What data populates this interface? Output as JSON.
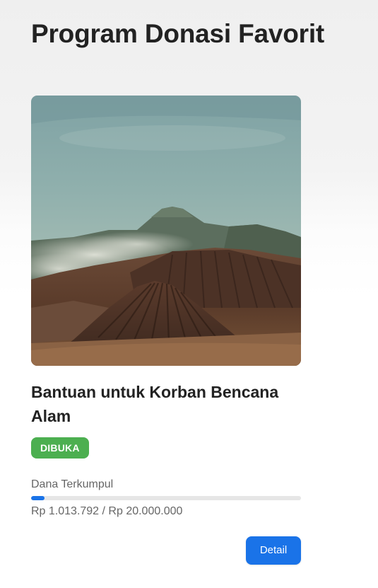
{
  "page": {
    "title": "Program Donasi Favorit"
  },
  "card": {
    "image_subject": "volcano-landscape-photo",
    "title": "Bantuan untuk Korban Bencana Alam",
    "status": "DIBUKA",
    "progress_label": "Dana Terkumpul",
    "collected": 1013792,
    "target": 20000000,
    "amount_text": "Rp 1.013.792 / Rp 20.000.000",
    "detail_label": "Detail"
  },
  "colors": {
    "accent": "#1a73e8",
    "status_open": "#4caf50",
    "title_text": "#222222",
    "muted_text": "#666666",
    "track": "#e6e6e6"
  }
}
